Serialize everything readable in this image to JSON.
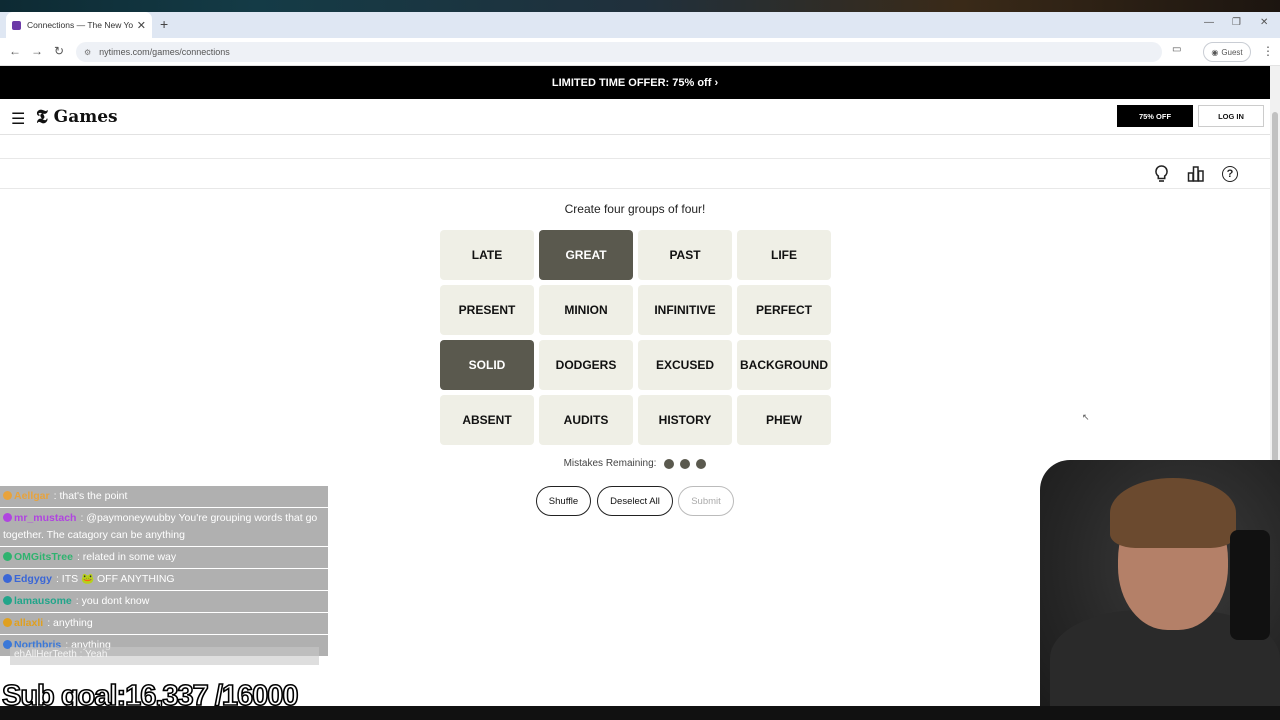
{
  "browser": {
    "tab_title": "Connections — The New York T",
    "tab_close": "✕",
    "new_tab": "+",
    "url": "nytimes.com/games/connections",
    "profile_label": "Guest",
    "window_controls": [
      "—",
      "❐",
      "✕"
    ]
  },
  "promo": {
    "text": "LIMITED TIME OFFER:  75% off ›"
  },
  "header": {
    "logo_mark": "𝕿",
    "logo_text": "Games",
    "offer_button": "75% OFF",
    "login_button": "LOG IN"
  },
  "toolbar": {
    "icons": [
      "hint-icon",
      "stats-icon",
      "help-icon"
    ],
    "help_glyph": "?"
  },
  "game": {
    "instruction": "Create four groups of four!",
    "tiles": [
      {
        "label": "LATE",
        "selected": false
      },
      {
        "label": "GREAT",
        "selected": true
      },
      {
        "label": "PAST",
        "selected": false
      },
      {
        "label": "LIFE",
        "selected": false
      },
      {
        "label": "PRESENT",
        "selected": false
      },
      {
        "label": "MINION",
        "selected": false
      },
      {
        "label": "INFINITIVE",
        "selected": false
      },
      {
        "label": "PERFECT",
        "selected": false
      },
      {
        "label": "SOLID",
        "selected": true
      },
      {
        "label": "DODGERS",
        "selected": false
      },
      {
        "label": "EXCUSED",
        "selected": false
      },
      {
        "label": "BACKGROUND",
        "selected": false
      },
      {
        "label": "ABSENT",
        "selected": false
      },
      {
        "label": "AUDITS",
        "selected": false
      },
      {
        "label": "HISTORY",
        "selected": false
      },
      {
        "label": "PHEW",
        "selected": false
      }
    ],
    "mistakes_label": "Mistakes Remaining:",
    "mistakes_remaining": 3,
    "buttons": {
      "shuffle": "Shuffle",
      "deselect": "Deselect All",
      "submit": "Submit"
    },
    "selected_color": "#5a594e",
    "tile_color": "#efefe6"
  },
  "chat": {
    "messages": [
      {
        "user": "Aellgar",
        "user_color": "#e8a33c",
        "text": ": that's the point"
      },
      {
        "user": "mr_mustach",
        "user_color": "#b044e0",
        "text": ": @paymoneywubby You're grouping words that go together. The catagory can be anything"
      },
      {
        "user": "OMGitsTree",
        "user_color": "#2fb36f",
        "text": ": related in some way"
      },
      {
        "user": "Edgygy",
        "user_color": "#3a66d6",
        "text": ": ITS 🐸 OFF ANYTHING"
      },
      {
        "user": "lamausome",
        "user_color": "#22a58a",
        "text": ": you dont know"
      },
      {
        "user": "allaxli",
        "user_color": "#e0a020",
        "text": ": anything"
      },
      {
        "user": "Northbris",
        "user_color": "#3a78d8",
        "text": ": anything"
      }
    ],
    "faded_message": "ehAllHerTeeth : Yeah",
    "sub_goal": "Sub goal:16,337 /16000"
  }
}
